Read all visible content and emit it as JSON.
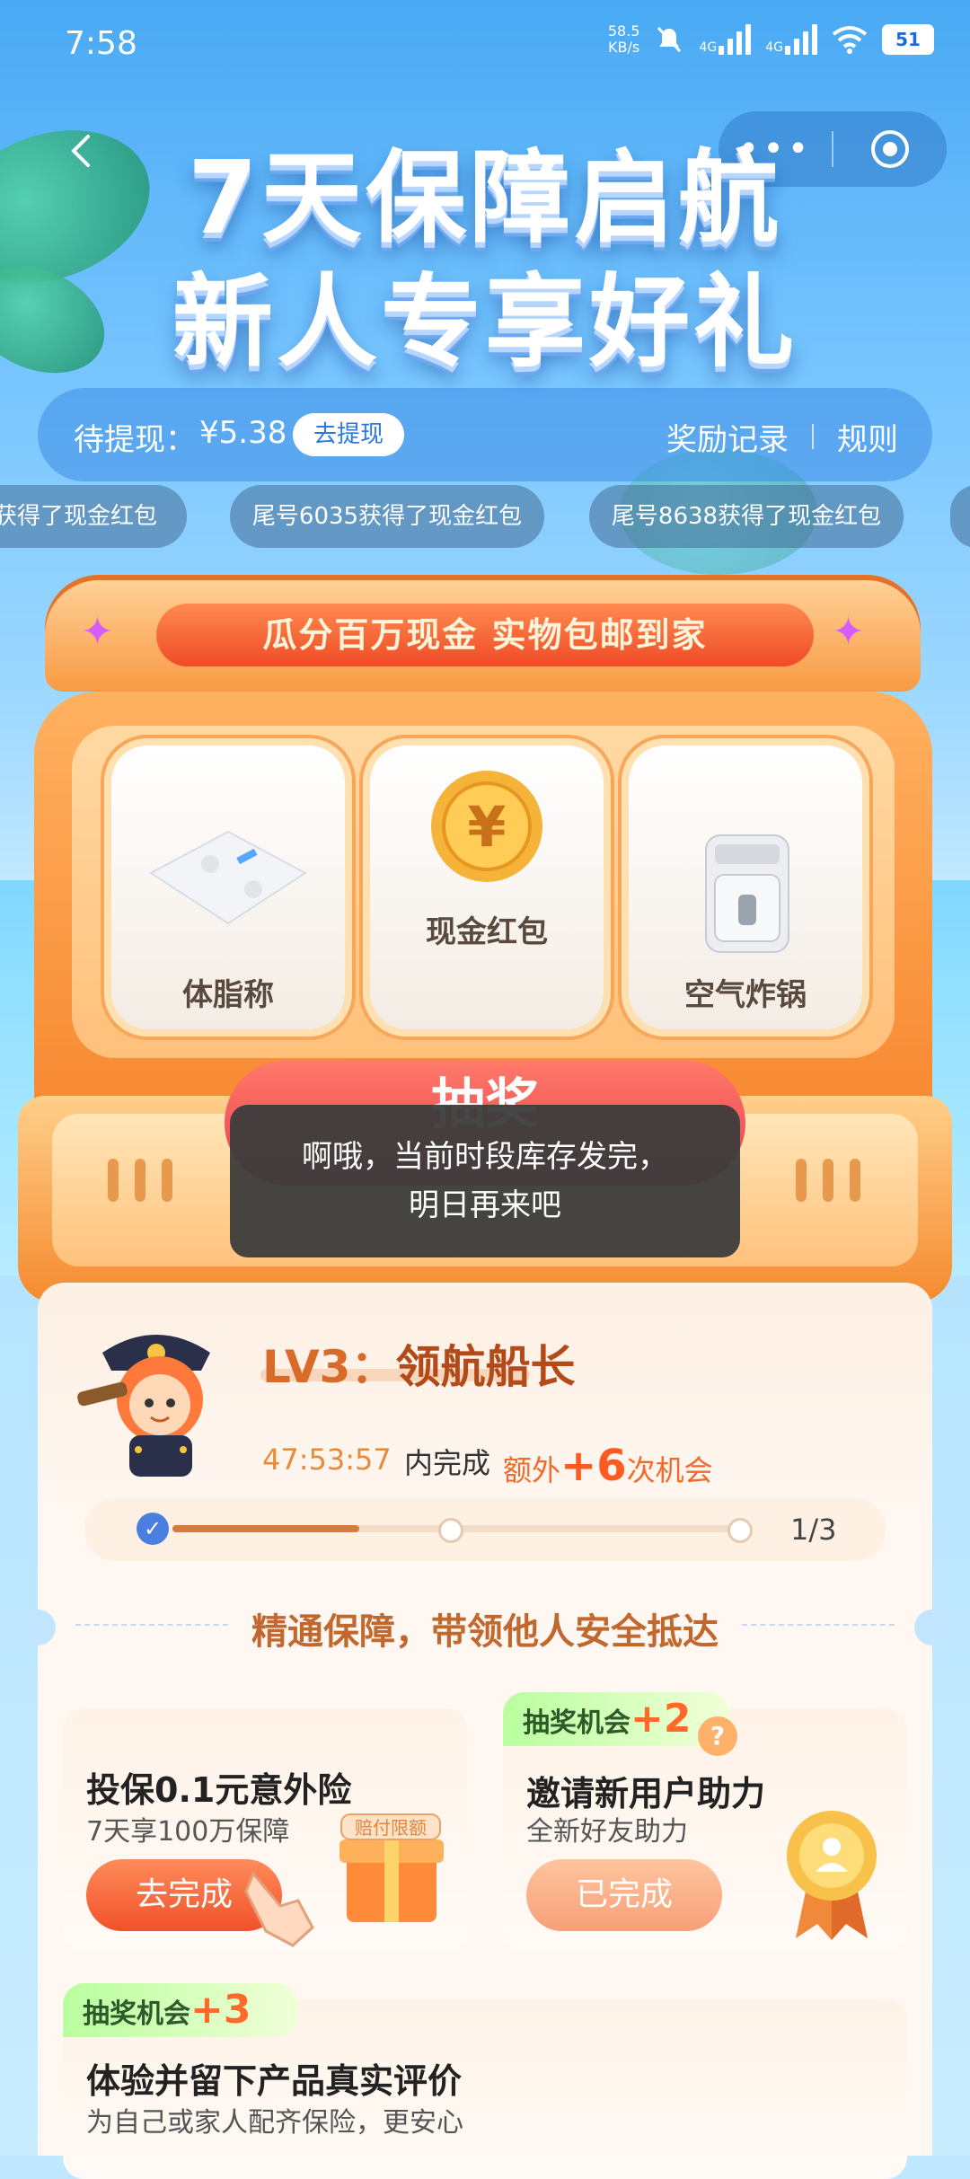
{
  "status_bar": {
    "time": "7:58",
    "net_speed_value": "58.5",
    "net_speed_unit": "KB/s",
    "signal1": "4G",
    "signal2": "4G",
    "battery": "51"
  },
  "nav": {
    "more_label": "•••"
  },
  "title": {
    "line1": "7天保障启航",
    "line2": "新人专享好礼"
  },
  "cash_bar": {
    "label": "待提现：",
    "amount": "¥5.38",
    "withdraw": "去提现",
    "records": "奖励记录",
    "rules": "规则"
  },
  "ticker": [
    "获得了现金红包",
    "尾号6035获得了现金红包",
    "尾号8638获得了现金红包"
  ],
  "machine": {
    "banner": "瓜分百万现金 实物包邮到家",
    "reels": [
      "体脂称",
      "现金红包",
      "空气炸锅"
    ],
    "draw_button": "抽奖"
  },
  "toast": {
    "line1": "啊哦，当前时段库存发完，",
    "line2": "明日再来吧"
  },
  "level": {
    "lv": "LV3：",
    "name": "领航船长",
    "countdown": "47:53:57",
    "complete_in": "内完成",
    "extra_prefix": "额外",
    "extra_num": "+6",
    "extra_suffix": "次机会",
    "progress_text": "1/3",
    "progress_fraction": 0.33
  },
  "section_title": "精通保障，带领他人安全抵达",
  "tasks": [
    {
      "title": "投保0.1元意外险",
      "subtitle": "7天享100万保障",
      "button": "去完成",
      "gift_tag": "赔付限额"
    },
    {
      "chance_label": "抽奖机会",
      "chance_plus": "+2",
      "title": "邀请新用户助力",
      "subtitle": "全新好友助力",
      "button": "已完成"
    },
    {
      "chance_label": "抽奖机会",
      "chance_plus": "+3",
      "title": "体验并留下产品真实评价",
      "subtitle": "为自己或家人配齐保险，更安心"
    }
  ]
}
